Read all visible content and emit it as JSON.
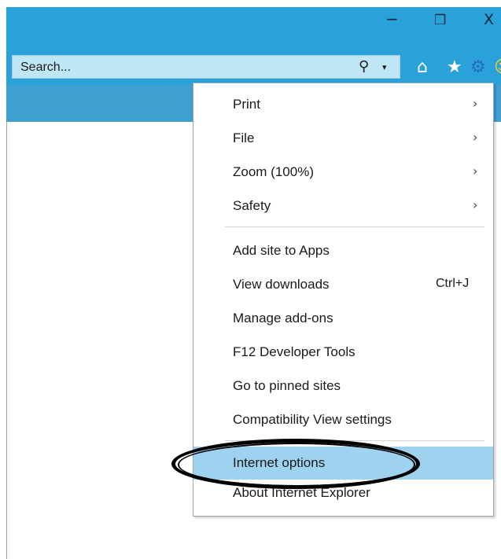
{
  "window": {
    "minimize_glyph": "−",
    "restore_glyph": "❐",
    "close_glyph": "X"
  },
  "search": {
    "placeholder": "Search...",
    "icon": "search-icon",
    "dropdown_glyph": "▾"
  },
  "toolbar_icons": [
    "home-icon",
    "star-icon",
    "gear-icon",
    "smile-icon"
  ],
  "menu": {
    "items": [
      {
        "label": "Print",
        "submenu": true
      },
      {
        "label": "File",
        "submenu": true
      },
      {
        "label": "Zoom (100%)",
        "submenu": true
      },
      {
        "label": "Safety",
        "submenu": true
      },
      {
        "label": "Add site to Apps"
      },
      {
        "label": "View downloads",
        "shortcut": "Ctrl+J"
      },
      {
        "label": "Manage add-ons"
      },
      {
        "label": "F12 Developer Tools"
      },
      {
        "label": "Go to pinned sites"
      },
      {
        "label": "Compatibility View settings"
      },
      {
        "label": "Internet options",
        "selected": true
      },
      {
        "label": "About Internet Explorer"
      }
    ],
    "arrow_glyph": "›"
  },
  "colors": {
    "titlebar": "#2aa1d8",
    "tabstrip": "#3e9fd1",
    "selected_item": "#9fd2ef"
  }
}
